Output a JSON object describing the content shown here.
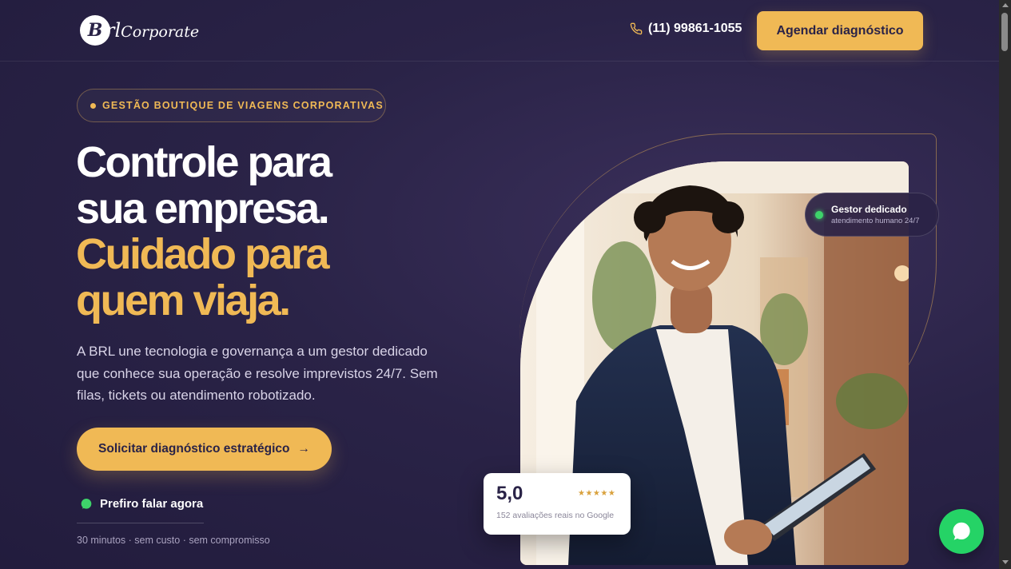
{
  "header": {
    "logo_mark": "B",
    "logo_text_b": "rl",
    "logo_text_rest": "Corporate",
    "phone": "(11) 99861-1055",
    "cta": "Agendar diagnóstico"
  },
  "hero": {
    "badge": "GESTÃO BOUTIQUE DE VIAGENS CORPORATIVAS",
    "headline_line1": "Controle para",
    "headline_line2": "sua empresa.",
    "headline_line3": "Cuidado para",
    "headline_line4": "quem viaja.",
    "lead": "A BRL une tecnologia e governança a um gestor dedicado que conhece sua operação e resolve imprevistos 24/7. Sem filas, tickets ou atendimento robotizado.",
    "cta": "Solicitar diagnóstico estratégico",
    "cta_arrow": "→",
    "talk_link": "Prefiro falar agora",
    "fine_print": "30 minutos · sem custo · sem compromisso"
  },
  "visual": {
    "pill_title": "Gestor dedicado",
    "pill_sub": "atendimento humano 24/7",
    "rating_score": "5,0",
    "rating_stars": "★★★★★",
    "rating_text": "152 avaliações reais no Google"
  },
  "colors": {
    "background": "#2a2347",
    "accent": "#f0b955",
    "online": "#3ed36a",
    "whatsapp": "#25d366"
  },
  "icons": {
    "phone": "phone-icon",
    "talk": "whatsapp-icon",
    "chat": "chat-bubble-icon"
  }
}
